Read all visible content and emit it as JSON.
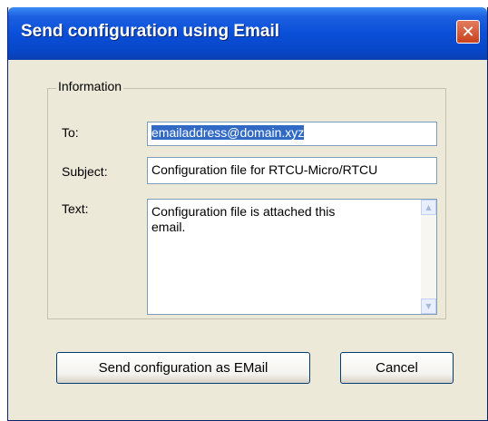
{
  "window": {
    "title": "Send configuration using Email",
    "close_glyph": "✕"
  },
  "group": {
    "title": "Information"
  },
  "form": {
    "to_label": "To:",
    "to_value": "emailaddress@domain.xyz",
    "subject_label": "Subject:",
    "subject_value": "Configuration file for RTCU-Micro/RTCU",
    "text_label": "Text:",
    "text_value": "Configuration file is attached this\nemail."
  },
  "scrollbar": {
    "up_glyph": "▲",
    "down_glyph": "▼"
  },
  "buttons": {
    "send_label": "Send configuration as EMail",
    "cancel_label": "Cancel"
  },
  "colors": {
    "titlebar": "#0a4fd8",
    "selection": "#316ac5",
    "dialog_bg": "#ece9d8",
    "close": "#c8421e"
  }
}
